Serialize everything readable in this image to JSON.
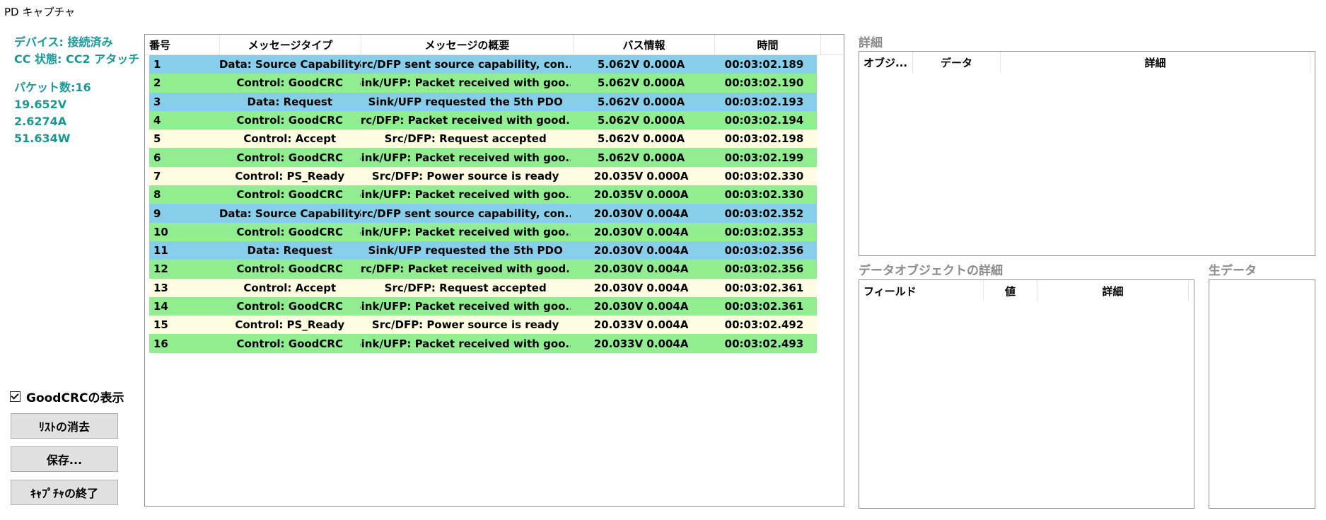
{
  "window": {
    "title": "PD キャプチャ"
  },
  "status": {
    "device": "デバイス: 接続済み",
    "cc_state": "CC 状態: CC2 アタッチ",
    "packet_count": "パケット数:16",
    "voltage": "19.652V",
    "current": "2.6274A",
    "power": "51.634W"
  },
  "controls": {
    "show_goodcrc": "GoodCRCの表示",
    "show_goodcrc_checked": true,
    "clear_button": "ﾘｽﾄの消去",
    "save_button": "保存...",
    "end_button": "ｷｬﾌﾟﾁｬの終了"
  },
  "colors": {
    "source_cap": "#87ceeb",
    "request": "#87ceeb",
    "goodcrc": "#90ee90",
    "accept": "#fffde1",
    "ps_ready": "#fffde1",
    "status_text": "#19989a"
  },
  "message_list": {
    "columns": [
      "番号",
      "メッセージタイプ",
      "メッセージの概要",
      "バス情報",
      "時間"
    ],
    "rows": [
      {
        "no": "1",
        "type": "Data: Source Capability",
        "summary": "Src/DFP sent source capability, con...",
        "bus": "5.062V 0.000A",
        "time": "00:03:02.189",
        "color": "source_cap"
      },
      {
        "no": "2",
        "type": "Control: GoodCRC",
        "summary": "Sink/UFP: Packet received with goo...",
        "bus": "5.062V 0.000A",
        "time": "00:03:02.190",
        "color": "goodcrc"
      },
      {
        "no": "3",
        "type": "Data: Request",
        "summary": "Sink/UFP requested the 5th PDO",
        "bus": "5.062V 0.000A",
        "time": "00:03:02.193",
        "color": "request"
      },
      {
        "no": "4",
        "type": "Control: GoodCRC",
        "summary": "Src/DFP: Packet received with good...",
        "bus": "5.062V 0.000A",
        "time": "00:03:02.194",
        "color": "goodcrc"
      },
      {
        "no": "5",
        "type": "Control: Accept",
        "summary": "Src/DFP: Request accepted",
        "bus": "5.062V 0.000A",
        "time": "00:03:02.198",
        "color": "accept"
      },
      {
        "no": "6",
        "type": "Control: GoodCRC",
        "summary": "Sink/UFP: Packet received with goo...",
        "bus": "5.062V 0.000A",
        "time": "00:03:02.199",
        "color": "goodcrc"
      },
      {
        "no": "7",
        "type": "Control: PS_Ready",
        "summary": "Src/DFP: Power source is ready",
        "bus": "20.035V 0.000A",
        "time": "00:03:02.330",
        "color": "ps_ready"
      },
      {
        "no": "8",
        "type": "Control: GoodCRC",
        "summary": "Sink/UFP: Packet received with goo...",
        "bus": "20.035V 0.000A",
        "time": "00:03:02.330",
        "color": "goodcrc"
      },
      {
        "no": "9",
        "type": "Data: Source Capability",
        "summary": "Src/DFP sent source capability, con...",
        "bus": "20.030V 0.004A",
        "time": "00:03:02.352",
        "color": "source_cap"
      },
      {
        "no": "10",
        "type": "Control: GoodCRC",
        "summary": "Sink/UFP: Packet received with goo...",
        "bus": "20.030V 0.004A",
        "time": "00:03:02.353",
        "color": "goodcrc"
      },
      {
        "no": "11",
        "type": "Data: Request",
        "summary": "Sink/UFP requested the 5th PDO",
        "bus": "20.030V 0.004A",
        "time": "00:03:02.356",
        "color": "request"
      },
      {
        "no": "12",
        "type": "Control: GoodCRC",
        "summary": "Src/DFP: Packet received with good...",
        "bus": "20.030V 0.004A",
        "time": "00:03:02.356",
        "color": "goodcrc"
      },
      {
        "no": "13",
        "type": "Control: Accept",
        "summary": "Src/DFP: Request accepted",
        "bus": "20.030V 0.004A",
        "time": "00:03:02.361",
        "color": "accept"
      },
      {
        "no": "14",
        "type": "Control: GoodCRC",
        "summary": "Sink/UFP: Packet received with goo...",
        "bus": "20.030V 0.004A",
        "time": "00:03:02.361",
        "color": "goodcrc"
      },
      {
        "no": "15",
        "type": "Control: PS_Ready",
        "summary": "Src/DFP: Power source is ready",
        "bus": "20.033V 0.004A",
        "time": "00:03:02.492",
        "color": "ps_ready"
      },
      {
        "no": "16",
        "type": "Control: GoodCRC",
        "summary": "Sink/UFP: Packet received with goo...",
        "bus": "20.033V 0.004A",
        "time": "00:03:02.493",
        "color": "goodcrc"
      }
    ]
  },
  "details": {
    "title": "詳細",
    "columns": [
      "オブジ...",
      "データ",
      "詳細"
    ]
  },
  "data_object_details": {
    "title": "データオブジェクトの詳細",
    "columns": [
      "フィールド",
      "値",
      "詳細"
    ]
  },
  "raw_data": {
    "title": "生データ"
  }
}
